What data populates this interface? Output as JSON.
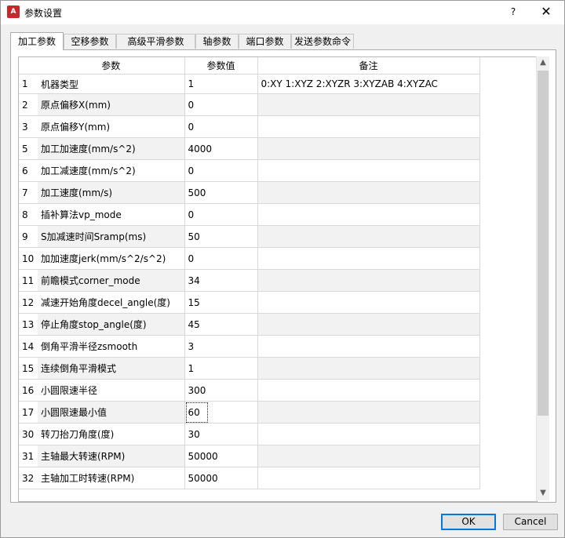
{
  "window": {
    "title": "参数设置",
    "app_icon_text": "A",
    "help_label": "?",
    "close_label": "✕"
  },
  "tabs": [
    "加工参数",
    "空移参数",
    "高级平滑参数",
    "轴参数",
    "端口参数",
    "发送参数命令"
  ],
  "active_tab": "加工参数",
  "table": {
    "headers": {
      "row_num": "",
      "param": "参数",
      "value": "参数值",
      "note": "备注"
    },
    "rows": [
      {
        "num": "1",
        "param": "机器类型",
        "value": "1",
        "note": "0:XY  1:XYZ  2:XYZR   3:XYZAB   4:XYZAC"
      },
      {
        "num": "2",
        "param": "原点偏移X(mm)",
        "value": "0",
        "note": ""
      },
      {
        "num": "3",
        "param": "原点偏移Y(mm)",
        "value": "0",
        "note": ""
      },
      {
        "num": "5",
        "param": "加工加速度(mm/s^2)",
        "value": "4000",
        "note": ""
      },
      {
        "num": "6",
        "param": "加工减速度(mm/s^2)",
        "value": "0",
        "note": ""
      },
      {
        "num": "7",
        "param": "加工速度(mm/s)",
        "value": "500",
        "note": ""
      },
      {
        "num": "8",
        "param": "插补算法vp_mode",
        "value": "0",
        "note": ""
      },
      {
        "num": "9",
        "param": "S加减速时间Sramp(ms)",
        "value": "50",
        "note": ""
      },
      {
        "num": "10",
        "param": "加加速度jerk(mm/s^2/s^2)",
        "value": "0",
        "note": ""
      },
      {
        "num": "11",
        "param": "前瞻模式corner_mode",
        "value": "34",
        "note": ""
      },
      {
        "num": "12",
        "param": "减速开始角度decel_angle(度)",
        "value": "15",
        "note": ""
      },
      {
        "num": "13",
        "param": "停止角度stop_angle(度)",
        "value": "45",
        "note": ""
      },
      {
        "num": "14",
        "param": "倒角平滑半径zsmooth",
        "value": "3",
        "note": ""
      },
      {
        "num": "15",
        "param": "连续倒角平滑模式",
        "value": "1",
        "note": ""
      },
      {
        "num": "16",
        "param": "小圆限速半径",
        "value": "300",
        "note": ""
      },
      {
        "num": "17",
        "param": "小圆限速最小值",
        "value": "60",
        "note": ""
      },
      {
        "num": "30",
        "param": "转刀抬刀角度(度)",
        "value": "30",
        "note": ""
      },
      {
        "num": "31",
        "param": "主轴最大转速(RPM)",
        "value": "50000",
        "note": ""
      },
      {
        "num": "32",
        "param": "主轴加工时转速(RPM)",
        "value": "50000",
        "note": ""
      }
    ],
    "selected_row": 15
  },
  "scrollbar": {
    "up_icon": "scroll-up-arrow-icon",
    "down_icon": "scroll-down-arrow-icon"
  },
  "buttons": {
    "ok": "OK",
    "cancel": "Cancel"
  }
}
